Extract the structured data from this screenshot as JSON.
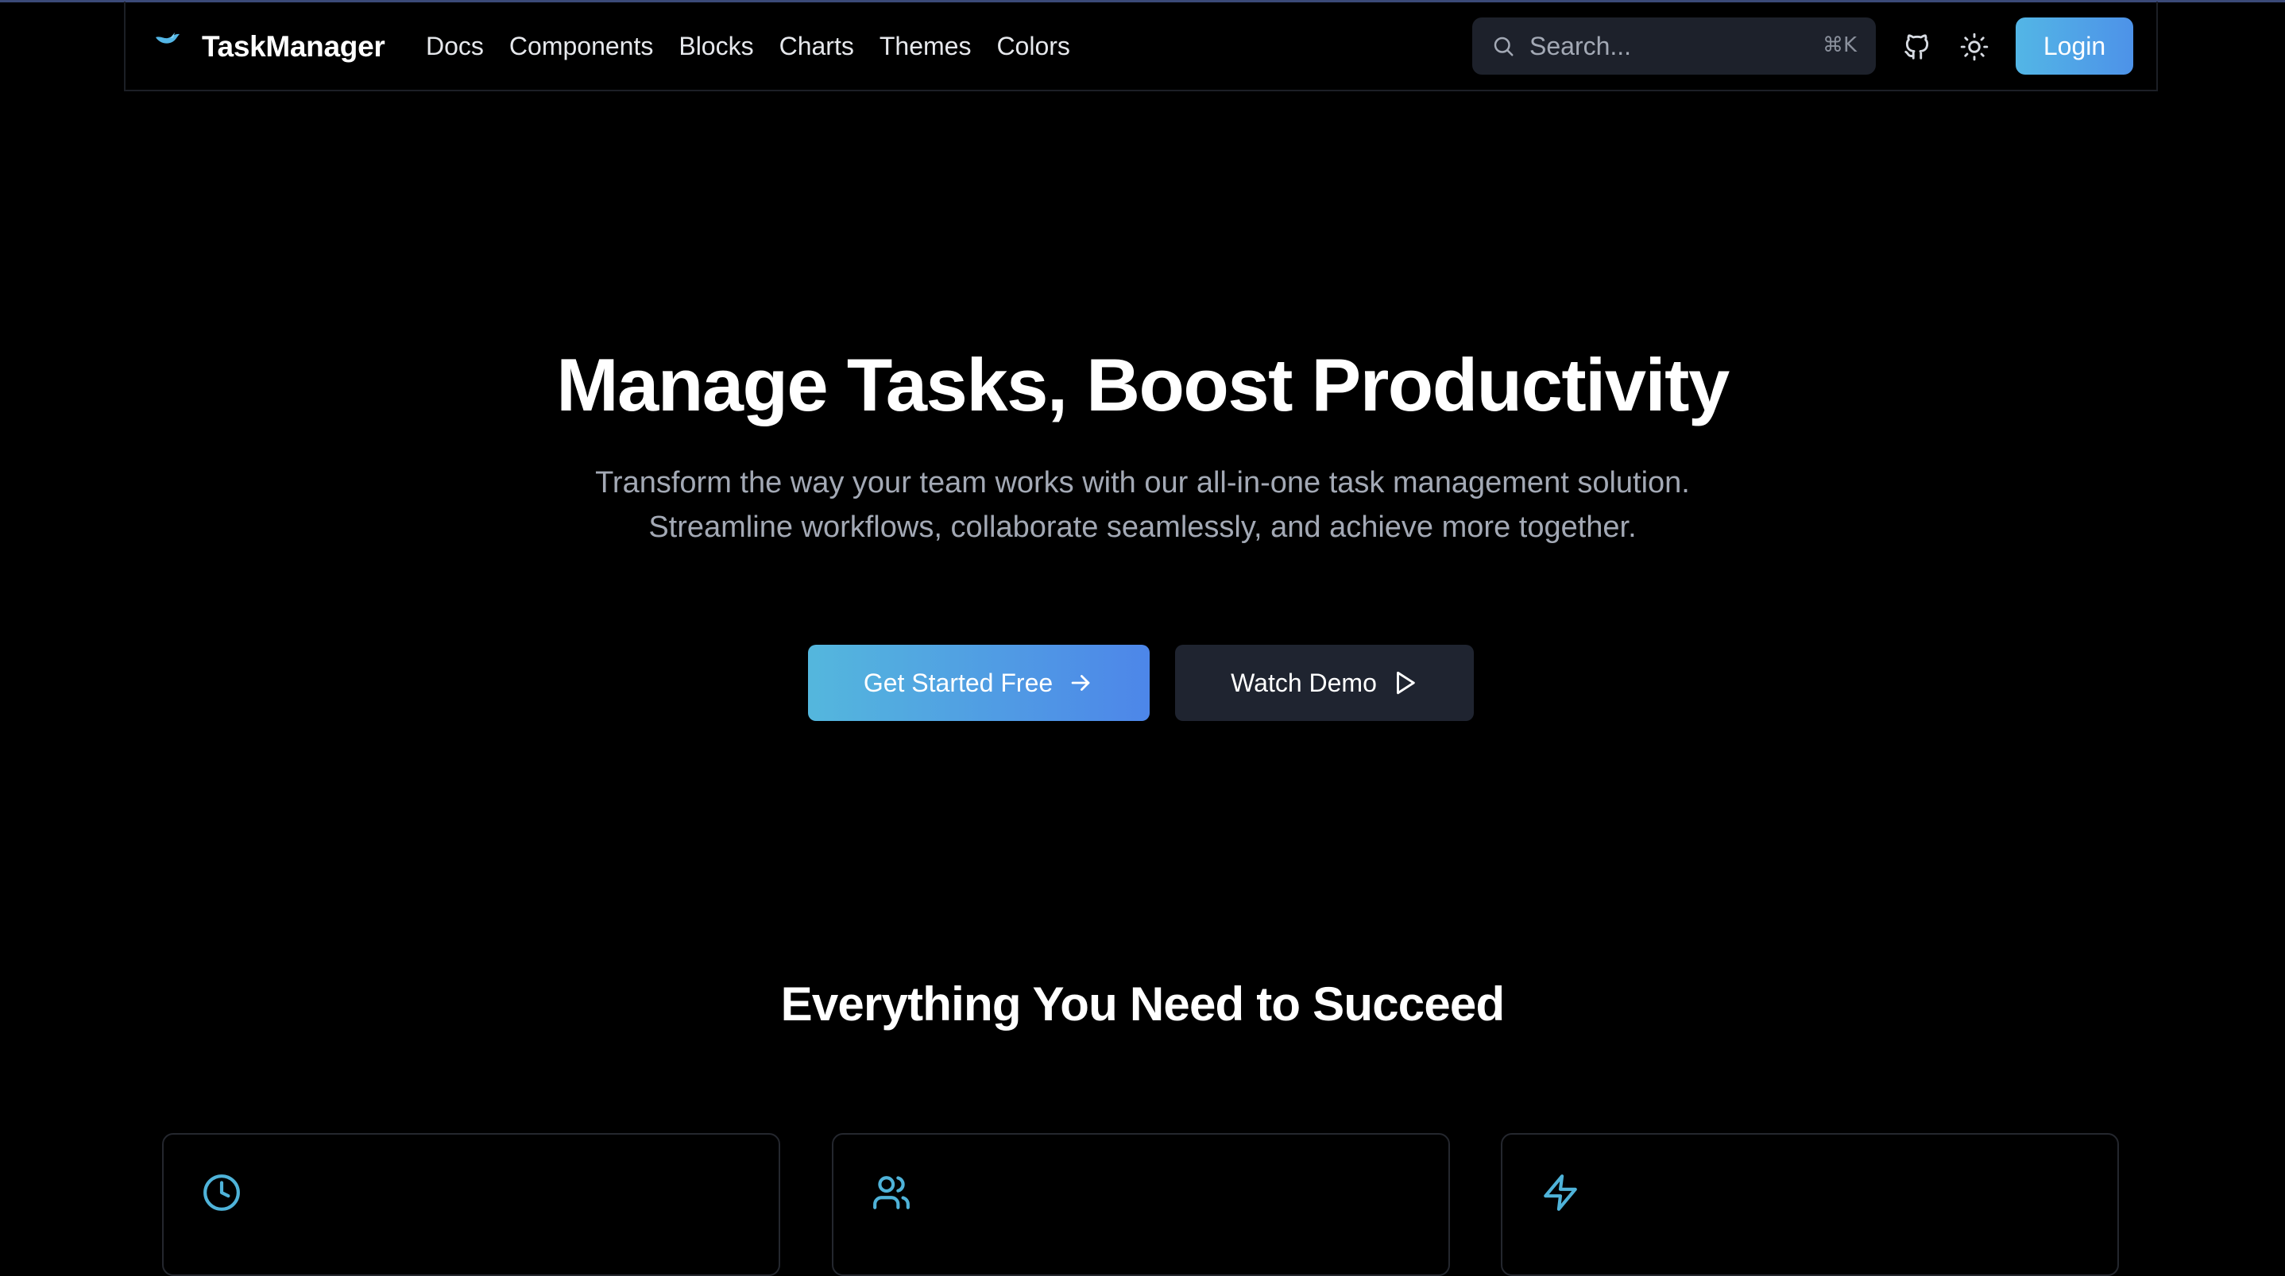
{
  "brand": {
    "name": "TaskManager",
    "icon": "bird-logo-icon",
    "accent": "#53b6e6"
  },
  "nav": {
    "items": [
      {
        "label": "Docs"
      },
      {
        "label": "Components"
      },
      {
        "label": "Blocks"
      },
      {
        "label": "Charts"
      },
      {
        "label": "Themes"
      },
      {
        "label": "Colors"
      }
    ]
  },
  "search": {
    "placeholder": "Search...",
    "shortcut": "⌘K",
    "icon": "search-icon"
  },
  "header_actions": {
    "github_icon": "github-icon",
    "theme_icon": "sun-icon",
    "login_label": "Login"
  },
  "hero": {
    "title": "Manage Tasks, Boost Productivity",
    "subtitle": "Transform the way your team works with our all-in-one task management solution. Streamline workflows, collaborate seamlessly, and achieve more together.",
    "primary_cta": "Get Started Free",
    "primary_cta_icon": "arrow-right-icon",
    "secondary_cta": "Watch Demo",
    "secondary_cta_icon": "play-icon"
  },
  "features": {
    "title": "Everything You Need to Succeed",
    "cards": [
      {
        "icon": "clock-icon"
      },
      {
        "icon": "users-icon"
      },
      {
        "icon": "lightning-icon"
      }
    ]
  },
  "colors": {
    "background": "#000000",
    "accent_start": "#54b7dd",
    "accent_end": "#4d86e9",
    "muted_text": "#a3a9b5",
    "icon_accent": "#4fb3d9"
  }
}
